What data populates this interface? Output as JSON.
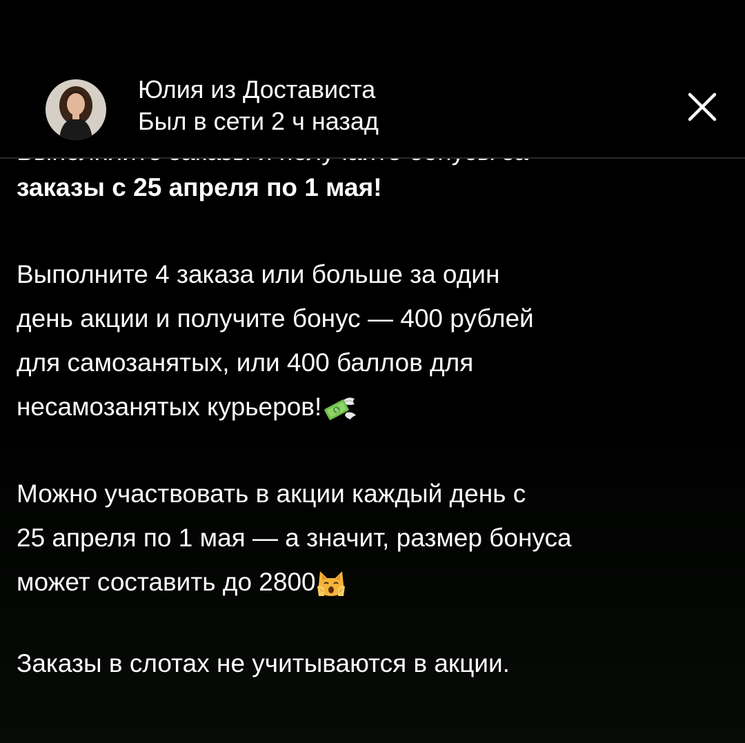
{
  "header": {
    "contact_name": "Юлия из Достависта",
    "status": "Был в сети 2 ч назад"
  },
  "icons": {
    "close": "close-icon",
    "money_emoji": "money-with-wings-emoji",
    "cat_emoji": "weary-cat-emoji"
  },
  "message": {
    "partial_top_line": "Выполняйте заказы и получайте бонусы за",
    "line_bold": "заказы с 25 апреля по 1 мая!",
    "paragraph1": [
      "Выполните 4 заказа или больше за один",
      "день акции и получите бонус — 400 рублей",
      "для самозанятых, или 400 баллов для",
      "несамозанятых курьеров!"
    ],
    "paragraph2": [
      "Можно участвовать в акции каждый день с",
      "25 апреля по 1 мая — а значит, размер бонуса",
      "может составить до 2800"
    ],
    "paragraph3": "Заказы в слотах не учитываются в акции."
  },
  "colors": {
    "background": "#000000",
    "text": "#ffffff",
    "divider": "#2a2a2a"
  }
}
